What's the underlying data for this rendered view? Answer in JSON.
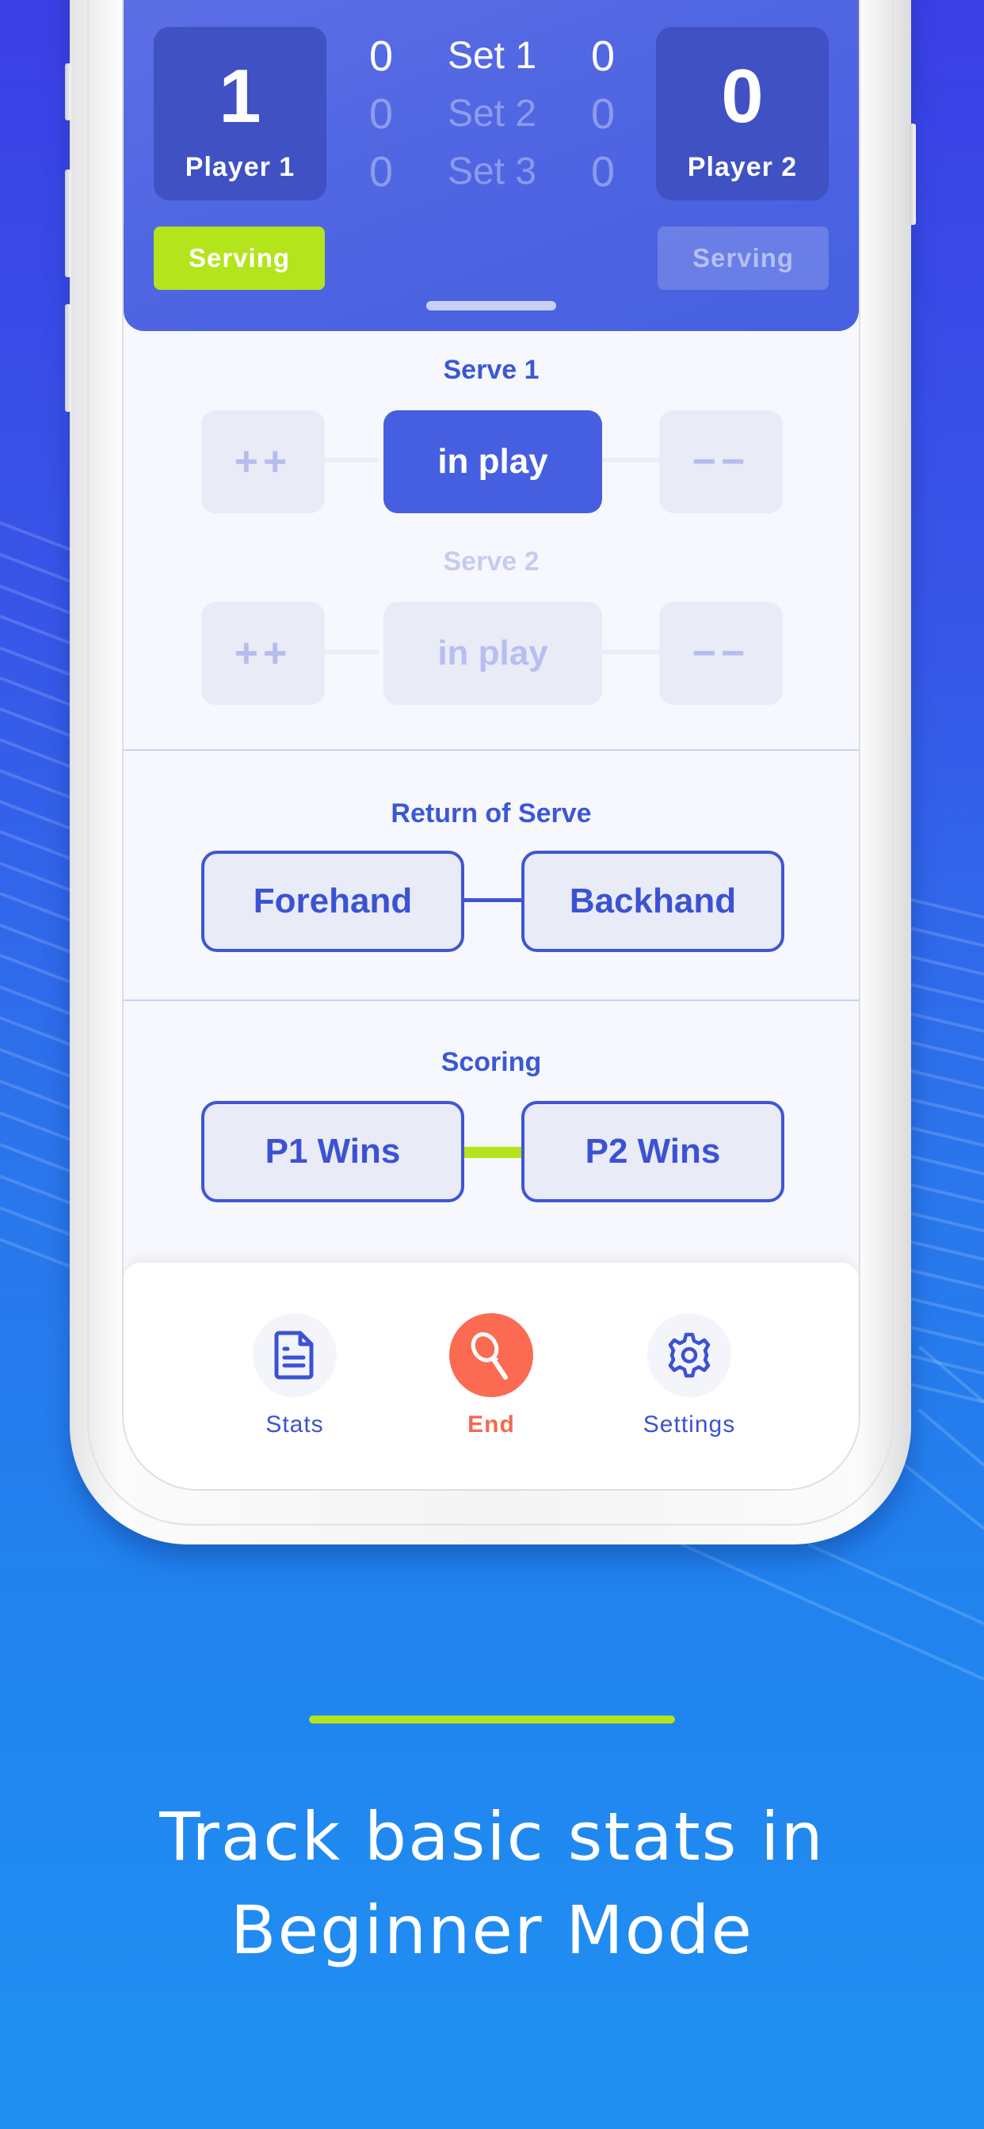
{
  "scoreboard": {
    "player1": {
      "name": "Player 1",
      "points": "1",
      "serving_label": "Serving",
      "is_serving": true
    },
    "player2": {
      "name": "Player 2",
      "points": "0",
      "serving_label": "Serving",
      "is_serving": false
    },
    "sets": [
      {
        "label": "Set 1",
        "p1": "0",
        "p2": "0",
        "active": true
      },
      {
        "label": "Set 2",
        "p1": "0",
        "p2": "0",
        "active": false
      },
      {
        "label": "Set 3",
        "p1": "0",
        "p2": "0",
        "active": false
      }
    ]
  },
  "serve1": {
    "title": "Serve 1",
    "ace_label": "++",
    "in_play_label": "in play",
    "fault_label": "−−",
    "selected": "in play"
  },
  "serve2": {
    "title": "Serve 2",
    "ace_label": "++",
    "in_play_label": "in play",
    "fault_label": "−−",
    "enabled": false
  },
  "return_of_serve": {
    "title": "Return of Serve",
    "options": [
      "Forehand",
      "Backhand"
    ]
  },
  "scoring": {
    "title": "Scoring",
    "options": [
      "P1 Wins",
      "P2 Wins"
    ]
  },
  "tabbar": {
    "items": [
      {
        "label": "Stats",
        "icon": "document-icon"
      },
      {
        "label": "End",
        "icon": "tennis-racket-icon",
        "accent": true
      },
      {
        "label": "Settings",
        "icon": "gear-icon"
      }
    ]
  },
  "marketing": {
    "tagline_line1": "Track basic stats in",
    "tagline_line2": "Beginner Mode"
  },
  "colors": {
    "primary": "#465ee0",
    "accent_green": "#b4e41c",
    "accent_orange": "#fb6b52",
    "header_blue": "#4f65e2"
  }
}
